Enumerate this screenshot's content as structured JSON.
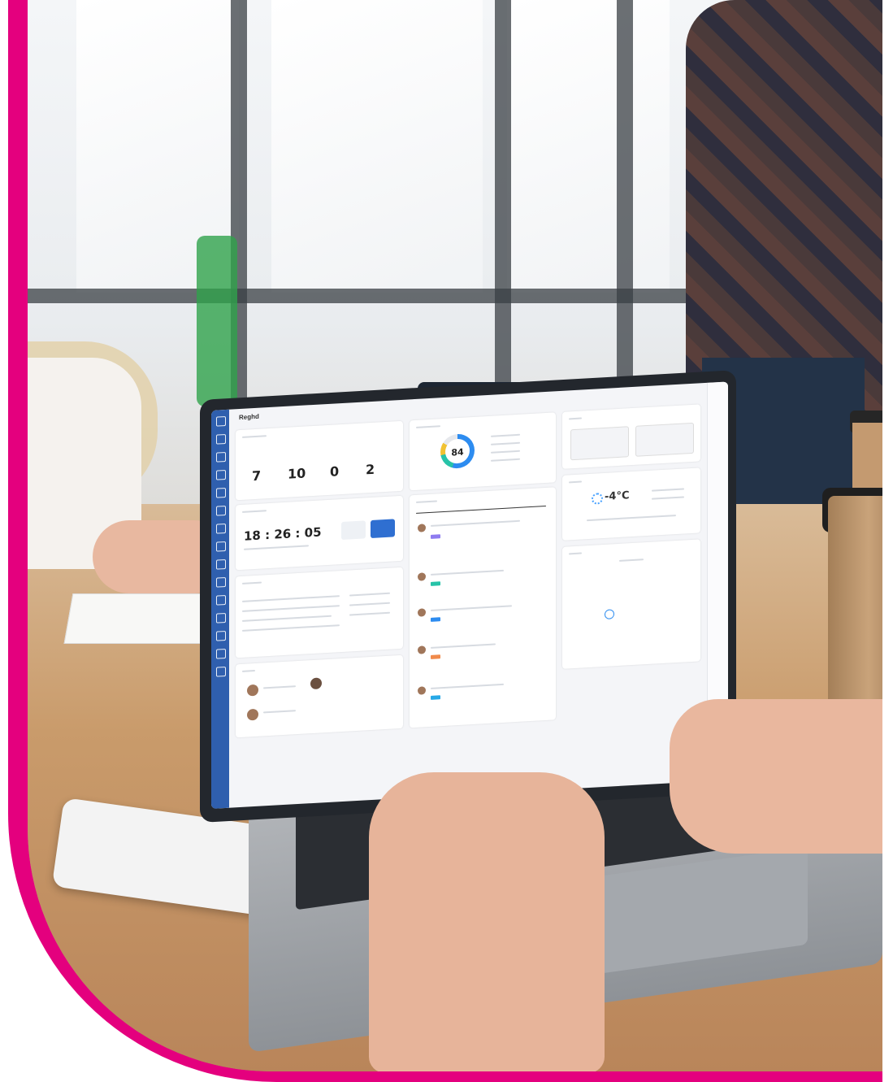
{
  "scene": {
    "description_colors": {
      "accent_band": "#e4007e",
      "sidebar": "#2f5fae"
    },
    "icons": [
      "home-icon",
      "calendar-icon",
      "mail-icon",
      "chart-icon",
      "settings-icon"
    ]
  },
  "dashboard": {
    "logo": "Reghd",
    "summary_numbers": [
      "7",
      "10",
      "0",
      "2"
    ],
    "attendance": {
      "clock": "18 : 26 : 05"
    },
    "gauge": {
      "value": "84"
    },
    "weather": {
      "temperature": "-4°C"
    }
  }
}
